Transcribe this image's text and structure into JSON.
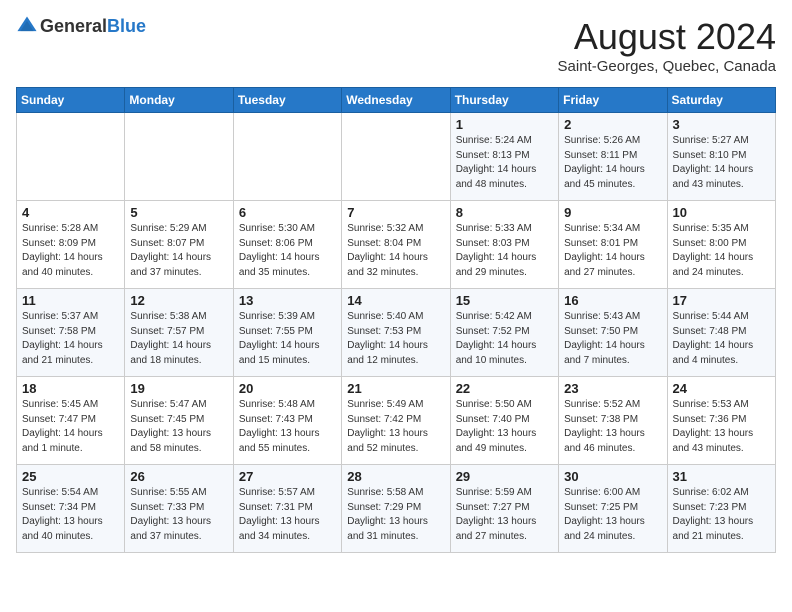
{
  "header": {
    "logo_general": "General",
    "logo_blue": "Blue",
    "month_year": "August 2024",
    "location": "Saint-Georges, Quebec, Canada"
  },
  "weekdays": [
    "Sunday",
    "Monday",
    "Tuesday",
    "Wednesday",
    "Thursday",
    "Friday",
    "Saturday"
  ],
  "weeks": [
    [
      {
        "day": "",
        "info": ""
      },
      {
        "day": "",
        "info": ""
      },
      {
        "day": "",
        "info": ""
      },
      {
        "day": "",
        "info": ""
      },
      {
        "day": "1",
        "info": "Sunrise: 5:24 AM\nSunset: 8:13 PM\nDaylight: 14 hours\nand 48 minutes."
      },
      {
        "day": "2",
        "info": "Sunrise: 5:26 AM\nSunset: 8:11 PM\nDaylight: 14 hours\nand 45 minutes."
      },
      {
        "day": "3",
        "info": "Sunrise: 5:27 AM\nSunset: 8:10 PM\nDaylight: 14 hours\nand 43 minutes."
      }
    ],
    [
      {
        "day": "4",
        "info": "Sunrise: 5:28 AM\nSunset: 8:09 PM\nDaylight: 14 hours\nand 40 minutes."
      },
      {
        "day": "5",
        "info": "Sunrise: 5:29 AM\nSunset: 8:07 PM\nDaylight: 14 hours\nand 37 minutes."
      },
      {
        "day": "6",
        "info": "Sunrise: 5:30 AM\nSunset: 8:06 PM\nDaylight: 14 hours\nand 35 minutes."
      },
      {
        "day": "7",
        "info": "Sunrise: 5:32 AM\nSunset: 8:04 PM\nDaylight: 14 hours\nand 32 minutes."
      },
      {
        "day": "8",
        "info": "Sunrise: 5:33 AM\nSunset: 8:03 PM\nDaylight: 14 hours\nand 29 minutes."
      },
      {
        "day": "9",
        "info": "Sunrise: 5:34 AM\nSunset: 8:01 PM\nDaylight: 14 hours\nand 27 minutes."
      },
      {
        "day": "10",
        "info": "Sunrise: 5:35 AM\nSunset: 8:00 PM\nDaylight: 14 hours\nand 24 minutes."
      }
    ],
    [
      {
        "day": "11",
        "info": "Sunrise: 5:37 AM\nSunset: 7:58 PM\nDaylight: 14 hours\nand 21 minutes."
      },
      {
        "day": "12",
        "info": "Sunrise: 5:38 AM\nSunset: 7:57 PM\nDaylight: 14 hours\nand 18 minutes."
      },
      {
        "day": "13",
        "info": "Sunrise: 5:39 AM\nSunset: 7:55 PM\nDaylight: 14 hours\nand 15 minutes."
      },
      {
        "day": "14",
        "info": "Sunrise: 5:40 AM\nSunset: 7:53 PM\nDaylight: 14 hours\nand 12 minutes."
      },
      {
        "day": "15",
        "info": "Sunrise: 5:42 AM\nSunset: 7:52 PM\nDaylight: 14 hours\nand 10 minutes."
      },
      {
        "day": "16",
        "info": "Sunrise: 5:43 AM\nSunset: 7:50 PM\nDaylight: 14 hours\nand 7 minutes."
      },
      {
        "day": "17",
        "info": "Sunrise: 5:44 AM\nSunset: 7:48 PM\nDaylight: 14 hours\nand 4 minutes."
      }
    ],
    [
      {
        "day": "18",
        "info": "Sunrise: 5:45 AM\nSunset: 7:47 PM\nDaylight: 14 hours\nand 1 minute."
      },
      {
        "day": "19",
        "info": "Sunrise: 5:47 AM\nSunset: 7:45 PM\nDaylight: 13 hours\nand 58 minutes."
      },
      {
        "day": "20",
        "info": "Sunrise: 5:48 AM\nSunset: 7:43 PM\nDaylight: 13 hours\nand 55 minutes."
      },
      {
        "day": "21",
        "info": "Sunrise: 5:49 AM\nSunset: 7:42 PM\nDaylight: 13 hours\nand 52 minutes."
      },
      {
        "day": "22",
        "info": "Sunrise: 5:50 AM\nSunset: 7:40 PM\nDaylight: 13 hours\nand 49 minutes."
      },
      {
        "day": "23",
        "info": "Sunrise: 5:52 AM\nSunset: 7:38 PM\nDaylight: 13 hours\nand 46 minutes."
      },
      {
        "day": "24",
        "info": "Sunrise: 5:53 AM\nSunset: 7:36 PM\nDaylight: 13 hours\nand 43 minutes."
      }
    ],
    [
      {
        "day": "25",
        "info": "Sunrise: 5:54 AM\nSunset: 7:34 PM\nDaylight: 13 hours\nand 40 minutes."
      },
      {
        "day": "26",
        "info": "Sunrise: 5:55 AM\nSunset: 7:33 PM\nDaylight: 13 hours\nand 37 minutes."
      },
      {
        "day": "27",
        "info": "Sunrise: 5:57 AM\nSunset: 7:31 PM\nDaylight: 13 hours\nand 34 minutes."
      },
      {
        "day": "28",
        "info": "Sunrise: 5:58 AM\nSunset: 7:29 PM\nDaylight: 13 hours\nand 31 minutes."
      },
      {
        "day": "29",
        "info": "Sunrise: 5:59 AM\nSunset: 7:27 PM\nDaylight: 13 hours\nand 27 minutes."
      },
      {
        "day": "30",
        "info": "Sunrise: 6:00 AM\nSunset: 7:25 PM\nDaylight: 13 hours\nand 24 minutes."
      },
      {
        "day": "31",
        "info": "Sunrise: 6:02 AM\nSunset: 7:23 PM\nDaylight: 13 hours\nand 21 minutes."
      }
    ]
  ]
}
